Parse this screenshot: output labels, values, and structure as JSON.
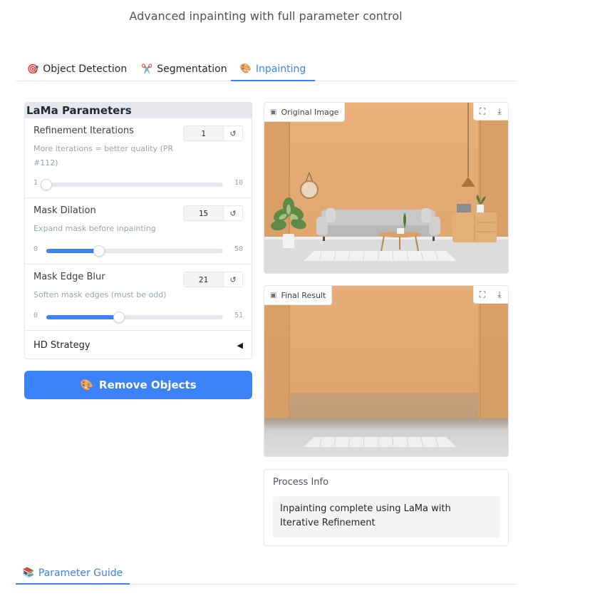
{
  "subtitle": "Advanced inpainting with full parameter control",
  "tabs": [
    {
      "icon": "🎯",
      "label": "Object Detection"
    },
    {
      "icon": "✂️",
      "label": "Segmentation"
    },
    {
      "icon": "🎨",
      "label": "Inpainting"
    }
  ],
  "active_tab": "Inpainting",
  "params": {
    "title": "LaMa Parameters",
    "refinement": {
      "label": "Refinement Iterations",
      "info": "More iterations = better quality (PR #112)",
      "value": "1",
      "min": "1",
      "max": "10",
      "level": 0
    },
    "dilation": {
      "label": "Mask Dilation",
      "info": "Expand mask before inpainting",
      "value": "15",
      "min": "0",
      "max": "50",
      "level": 0.3
    },
    "blur": {
      "label": "Mask Edge Blur",
      "info": "Soften mask edges (must be odd)",
      "value": "21",
      "min": "0",
      "max": "51",
      "level": 0.412
    },
    "hd_strategy": {
      "label": "HD Strategy",
      "arrow": "◀"
    },
    "reset_glyph": "↺"
  },
  "run_button": {
    "icon": "🎨",
    "label": "Remove Objects"
  },
  "original_image": {
    "label": "Original Image"
  },
  "final_result": {
    "label": "Final Result"
  },
  "image_actions": {
    "fullscreen": "⛶",
    "download": "⤓",
    "image_glyph": "▣"
  },
  "process_info": {
    "label": "Process Info",
    "text": "Inpainting complete using LaMa with Iterative Refinement"
  },
  "bottom_tab": {
    "icon": "📚",
    "label": "Parameter Guide"
  },
  "colors": {
    "accent": "#3b82f6",
    "wall": "#e7a96d",
    "floor": "#dcdcdc"
  }
}
